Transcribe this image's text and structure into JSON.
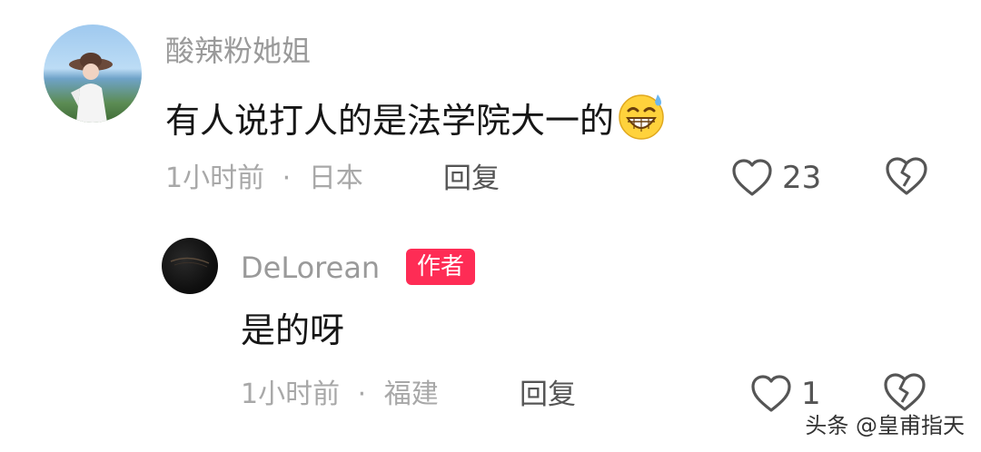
{
  "comments": [
    {
      "username": "酸辣粉她姐",
      "text": "有人说打人的是法学院大一的",
      "emoji": "grinning-sweat-emoji",
      "time": "1小时前",
      "location": "日本",
      "separator": "·",
      "reply_label": "回复",
      "likes": "23"
    },
    {
      "username": "DeLorean",
      "badge": "作者",
      "text": "是的呀",
      "time": "1小时前",
      "location": "福建",
      "separator": "·",
      "reply_label": "回复",
      "likes": "1"
    }
  ],
  "watermark": "头条 @皇甫指天",
  "colors": {
    "badge_bg": "#fe2c55",
    "username": "#9a9a9a",
    "meta": "#a8a8a8",
    "text": "#161616"
  }
}
